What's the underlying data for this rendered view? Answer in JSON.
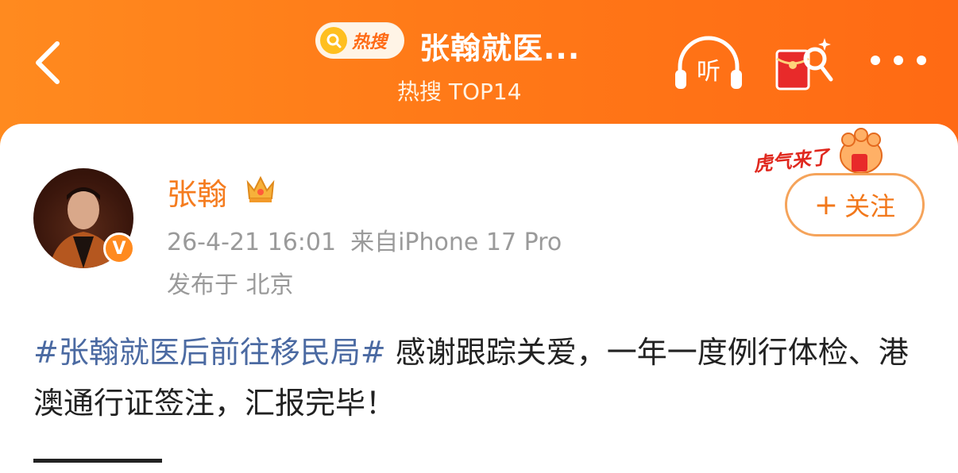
{
  "header": {
    "badge_label": "热搜",
    "title": "张翰就医...",
    "subtitle": "热搜 TOP14",
    "listen_label": "听"
  },
  "post": {
    "author": "张翰",
    "date": "26-4-21 16:01",
    "source": "来自iPhone 17 Pro",
    "location": "发布于 北京",
    "follow_label": "关注",
    "sticker_text": "虎气来了",
    "hashtag": "#张翰就医后前往移民局#",
    "body": " 感谢跟踪关爱，一年一度例行体检、港澳通行证签注，汇报完毕！"
  },
  "colors": {
    "header_orange": "#ff7a18",
    "username": "#f57c1f",
    "hashtag": "#4b6aa2",
    "meta_gray": "#9a9a9a"
  },
  "icons": {
    "back": "chevron-left-icon",
    "search_badge": "search-icon",
    "listen": "headphones-icon",
    "redpack": "red-envelope-search-icon",
    "more": "more-dots-icon",
    "crown": "crown-icon",
    "verified": "verified-badge-icon"
  }
}
